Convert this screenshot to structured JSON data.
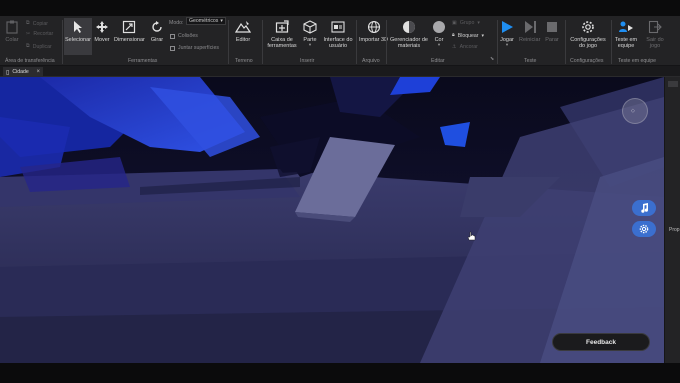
{
  "ribbon": {
    "clipboard": {
      "paste": "Colar",
      "copy": "Copiar",
      "cut": "Recortar",
      "duplicate": "Duplicar",
      "section": "Área de transferência"
    },
    "tools": {
      "select": "Selecionar",
      "move": "Mover",
      "scale": "Dimensionar",
      "rotate": "Girar",
      "mode_label": "Modo:",
      "mode_value": "Geométricos",
      "collisions": "Colisões",
      "join_surfaces": "Juntar superfícies",
      "section": "Ferramentas"
    },
    "terrain": {
      "editor": "Editor",
      "section": "Terreno"
    },
    "insert": {
      "toolbox": "Caixa de ferramentas",
      "part": "Parte",
      "ui": "Interface do usuário",
      "section": "Inserir"
    },
    "file": {
      "import3d": "Importar 3D",
      "section": "Arquivo"
    },
    "edit": {
      "material_manager": "Gerenciador de materiais",
      "color": "Cor",
      "group": "Grupo",
      "lock": "Bloquear",
      "anchor": "Ancorar",
      "section": "Editar"
    },
    "test": {
      "play": "Jogar",
      "resume": "Reiniciar",
      "stop": "Parar",
      "section": "Teste"
    },
    "settings": {
      "game_settings": "Configurações do jogo",
      "section": "Configurações"
    },
    "team_test": {
      "team_test": "Teste em equipe",
      "exit_game": "Sair do jogo",
      "section": "Teste em equipe"
    }
  },
  "tab": {
    "label": "Cidade"
  },
  "viewport": {
    "feedback": "Feedback",
    "accent": "#3b6fcf"
  },
  "right_panel": {
    "label": "Prop"
  }
}
